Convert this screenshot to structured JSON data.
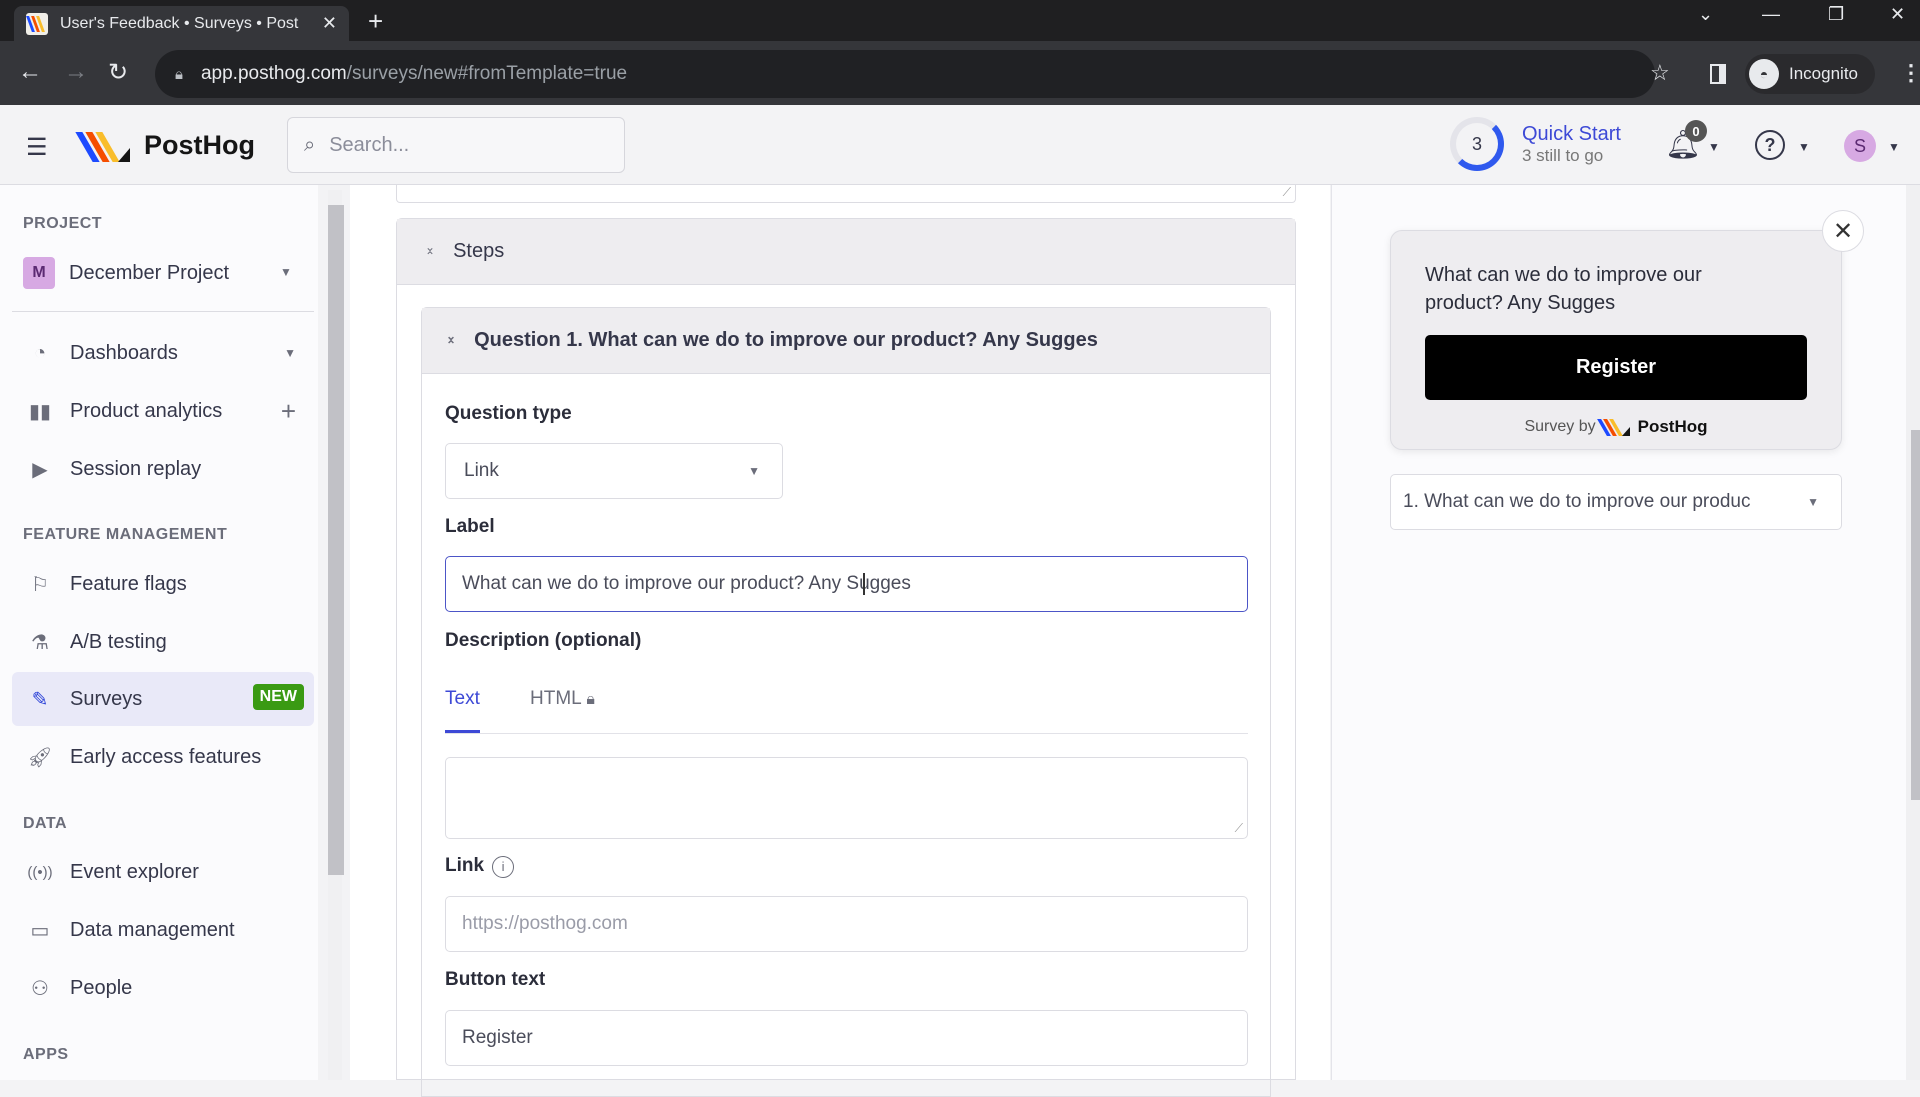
{
  "browser": {
    "tab_title": "User's Feedback • Surveys • PostHog",
    "tab_title_visible": "User's Feedback • Surveys • Post",
    "url_host": "app.posthog.com",
    "url_path": "/surveys/new#fromTemplate=true",
    "profile_label": "Incognito"
  },
  "header": {
    "brand": "PostHog",
    "search_placeholder": "Search...",
    "quick_start": {
      "count": "3",
      "title": "Quick Start",
      "subtitle": "3 still to go"
    },
    "notifications_count": "0",
    "user_initial": "S"
  },
  "sidebar": {
    "project_section": "PROJECT",
    "project_initial": "M",
    "project_name": "December Project",
    "items_top": [
      {
        "label": "Dashboards",
        "icon": "gauge-icon"
      },
      {
        "label": "Product analytics",
        "icon": "bar-chart-icon"
      },
      {
        "label": "Session replay",
        "icon": "play-square-icon"
      }
    ],
    "feature_section": "FEATURE MANAGEMENT",
    "items_feature": [
      {
        "label": "Feature flags",
        "icon": "flag-icon"
      },
      {
        "label": "A/B testing",
        "icon": "flask-icon"
      },
      {
        "label": "Surveys",
        "icon": "survey-icon",
        "badge": "NEW",
        "active": true
      },
      {
        "label": "Early access features",
        "icon": "rocket-icon"
      }
    ],
    "data_section": "DATA",
    "items_data": [
      {
        "label": "Event explorer",
        "icon": "broadcast-icon"
      },
      {
        "label": "Data management",
        "icon": "database-icon"
      },
      {
        "label": "People",
        "icon": "people-icon"
      }
    ],
    "apps_section": "APPS"
  },
  "editor": {
    "steps_title": "Steps",
    "question_header": "Question 1. What can we do to improve our product? Any Sugges",
    "question_type_label": "Question type",
    "question_type_value": "Link",
    "label_label": "Label",
    "label_value": "What can we do to improve our product? Any Sugges",
    "description_label": "Description (optional)",
    "desc_tabs": [
      "Text",
      "HTML"
    ],
    "description_value": "",
    "link_label": "Link",
    "link_placeholder": "https://posthog.com",
    "button_text_label": "Button text",
    "button_text_value": "Register"
  },
  "preview": {
    "question": "What can we do to improve our product? Any Sugges",
    "button": "Register",
    "survey_by": "Survey by",
    "brand": "PostHog",
    "selector_value": "1. What can we do to improve our produc"
  },
  "colors": {
    "accent": "#3d49d6",
    "badge_new": "#3a9a13",
    "quick_start_ring": "#2f59ee"
  }
}
